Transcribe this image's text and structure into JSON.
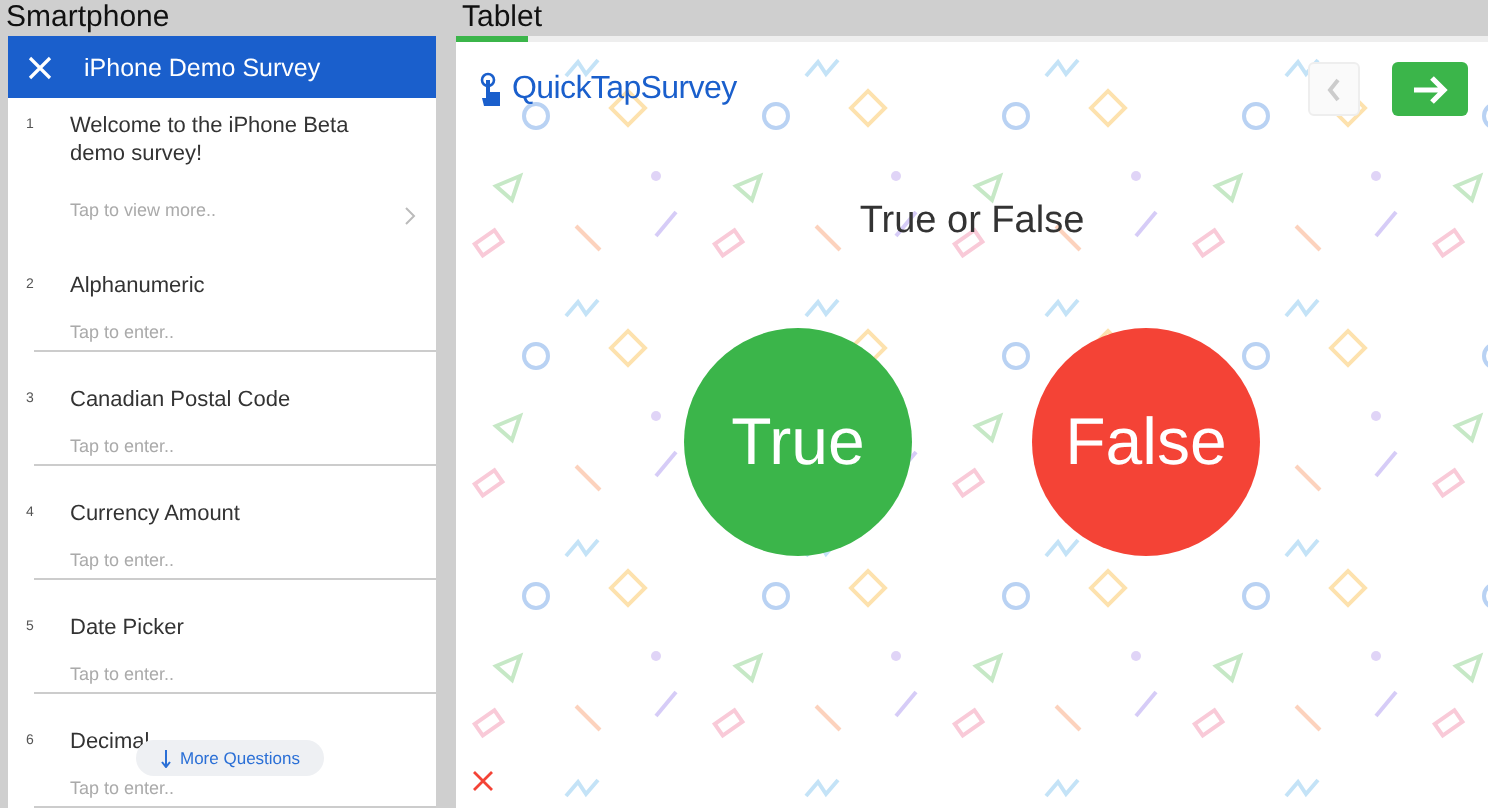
{
  "panels": {
    "phone_label": "Smartphone",
    "tablet_label": "Tablet"
  },
  "phone": {
    "title": "iPhone Demo Survey",
    "questions": [
      {
        "number": "1",
        "title": "Welcome to the iPhone Beta demo survey!",
        "hint": "Tap to view more..",
        "kind": "info"
      },
      {
        "number": "2",
        "title": "Alphanumeric",
        "hint": "Tap to enter..",
        "kind": "input"
      },
      {
        "number": "3",
        "title": "Canadian Postal Code",
        "hint": "Tap to enter..",
        "kind": "input"
      },
      {
        "number": "4",
        "title": "Currency Amount",
        "hint": "Tap to enter..",
        "kind": "input"
      },
      {
        "number": "5",
        "title": "Date Picker",
        "hint": "Tap to enter..",
        "kind": "input"
      },
      {
        "number": "6",
        "title": "Decimal",
        "hint": "Tap to enter..",
        "kind": "input"
      }
    ],
    "more_button": "More Questions"
  },
  "tablet": {
    "progress": {
      "level": 0.07
    },
    "logo": "QuickTapSurvey",
    "back_disabled": true,
    "question": "True or False",
    "options": [
      {
        "label": "True",
        "color": "#3bb54a"
      },
      {
        "label": "False",
        "color": "#f44336"
      }
    ]
  }
}
